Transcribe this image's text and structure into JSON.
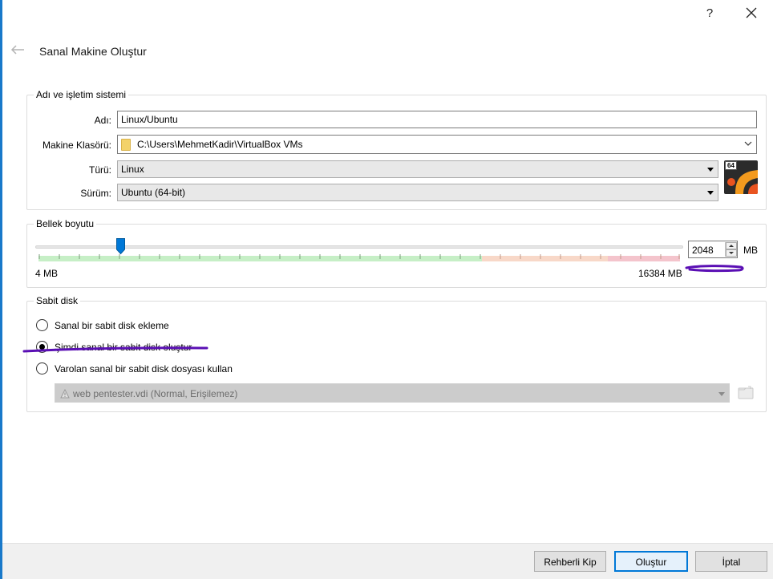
{
  "window": {
    "help_label": "?",
    "title": "Sanal Makine Oluştur"
  },
  "name_os_group": {
    "title": "Adı ve işletim sistemi",
    "name_label": "Adı:",
    "name_value": "Linux/Ubuntu",
    "folder_label": "Makine Klasörü:",
    "folder_value": "C:\\Users\\MehmetKadir\\VirtualBox VMs",
    "type_label": "Türü:",
    "type_value": "Linux",
    "version_label": "Sürüm:",
    "version_value": "Ubuntu (64-bit)",
    "os_icon_badge": "64"
  },
  "memory_group": {
    "title": "Bellek boyutu",
    "value": "2048",
    "unit": "MB",
    "min_label": "4 MB",
    "max_label": "16384 MB",
    "slider_min": 4,
    "slider_max": 16384,
    "slider_value": 2048
  },
  "disk_group": {
    "title": "Sabit disk",
    "options": [
      {
        "label": "Sanal bir sabit disk ekleme",
        "checked": false
      },
      {
        "label": "Şimdi sanal bir sabit disk oluştur",
        "checked": true
      },
      {
        "label": "Varolan sanal bir sabit disk dosyası kullan",
        "checked": false
      }
    ],
    "existing_disk_value": "web pentester.vdi (Normal, Erişilemez)"
  },
  "footer": {
    "guided_label": "Rehberli Kip",
    "create_label": "Oluştur",
    "cancel_label": "İptal"
  },
  "colors": {
    "accent": "#0078d7",
    "slider_green": "#c6efc6",
    "slider_orange": "#f8d8c8",
    "slider_red": "#f4c4cc",
    "annotation": "#5a0fb4"
  }
}
